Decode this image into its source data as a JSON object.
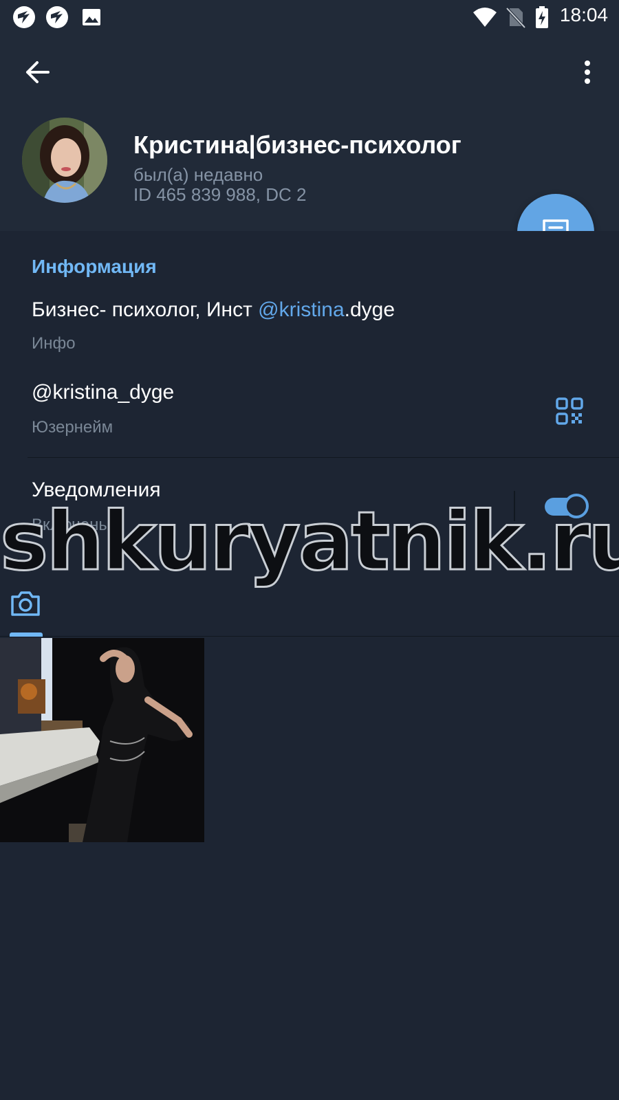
{
  "status_bar": {
    "time": "18:04",
    "icons": [
      "app-notification-icon",
      "app-notification-icon",
      "image-icon",
      "wifi-icon",
      "no-sim-icon",
      "battery-charging-icon"
    ]
  },
  "header": {
    "back_icon": "arrow-left-icon",
    "menu_icon": "more-vertical-icon",
    "name": "Кристина|бизнес-психолог",
    "last_seen": "был(а) недавно",
    "user_id": "ID 465 839 988, DC 2"
  },
  "fab": {
    "icon": "message-icon"
  },
  "info": {
    "section_title": "Информация",
    "bio": {
      "text_before": "Бизнес- психолог, Инст ",
      "link": "@kristina",
      "text_after": ".dyge",
      "label": "Инфо"
    },
    "username": {
      "value": "@kristina_dyge",
      "label": "Юзернейм",
      "icon": "qr-code-icon"
    },
    "notifications": {
      "title": "Уведомления",
      "state": "Включены",
      "enabled": true
    }
  },
  "watermark": "shkuryatnik.ru",
  "media": {
    "tab_icon": "camera-icon",
    "photo_count": 1
  },
  "colors": {
    "background": "#1d2533",
    "header": "#212a38",
    "accent": "#62a5e4",
    "section_title": "#71b8f5",
    "secondary_text": "#7a8796"
  }
}
